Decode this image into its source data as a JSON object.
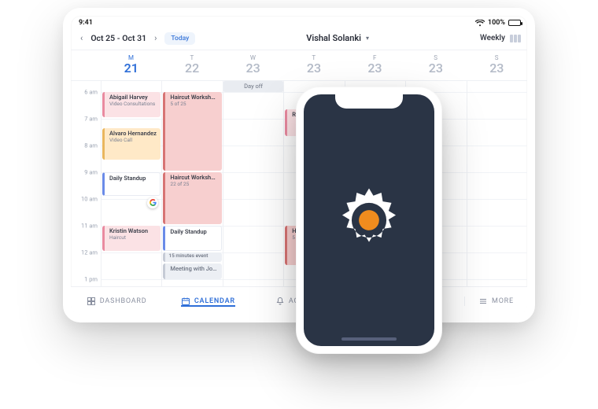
{
  "status": {
    "time": "9:41",
    "percent": "100%"
  },
  "topbar": {
    "date_range": "Oct 25 - Oct 31",
    "today": "Today",
    "user": "Vishal Solanki",
    "view": "Weekly"
  },
  "week": {
    "days": [
      {
        "label": "M",
        "num": "21",
        "active": true
      },
      {
        "label": "T",
        "num": "22",
        "active": false
      },
      {
        "label": "W",
        "num": "23",
        "active": false
      },
      {
        "label": "T",
        "num": "23",
        "active": false
      },
      {
        "label": "F",
        "num": "23",
        "active": false
      },
      {
        "label": "S",
        "num": "23",
        "active": false
      },
      {
        "label": "S",
        "num": "23",
        "active": false
      }
    ]
  },
  "times": [
    "6 am",
    "7 am",
    "8 am",
    "9 am",
    "10 am",
    "11 am",
    "12 am",
    "1 pm"
  ],
  "allday": {
    "dayoff": "Day off"
  },
  "events": {
    "abigail": {
      "title": "Abigail Harvey",
      "sub": "Video Consultations"
    },
    "alvaro": {
      "title": "Alvaro Hernandez",
      "sub": "Video Call"
    },
    "standup1": {
      "title": "Daily Standup",
      "sub": ""
    },
    "kristin": {
      "title": "Kristin Watson",
      "sub": "Haircut"
    },
    "workshop1": {
      "title": "Haircut Workshops",
      "sub": "5 of 25"
    },
    "workshop2": {
      "title": "Haircut Workshops",
      "sub": "22 of 25"
    },
    "standup2": {
      "title": "Daily Standup",
      "sub": ""
    },
    "fifteen": {
      "title": "15 minutes event"
    },
    "meeting": {
      "title": "Meeting with Jo…"
    },
    "regina": {
      "title": "Regina",
      "sub": ""
    },
    "haircut4": {
      "title": "Haircu",
      "sub": "5 of 25"
    }
  },
  "nav": {
    "dashboard": "DASHBOARD",
    "calendar": "CALENDAR",
    "activity": "ACTIVITY",
    "more": "MORE"
  }
}
